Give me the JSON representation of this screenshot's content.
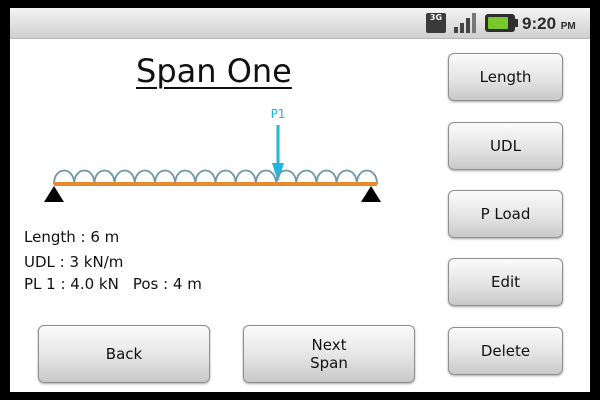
{
  "status_bar": {
    "network": "3G",
    "time": "9:20",
    "ampm": "PM",
    "icons": [
      "3g-icon",
      "signal-icon",
      "battery-icon"
    ]
  },
  "title": "Span One",
  "diagram": {
    "load_label": "P1",
    "colors": {
      "beam": "#e58a2d",
      "udl": "#6f98a7",
      "point_load": "#22b5e0",
      "support": "#000000"
    }
  },
  "info": {
    "length": "Length : 6 m",
    "udl": "UDL : 3 kN/m",
    "pl": "PL 1 : 4.0 kN",
    "pos": "Pos : 4 m"
  },
  "buttons": {
    "length": "Length",
    "udl": "UDL",
    "pload": "P Load",
    "edit": "Edit",
    "delete": "Delete",
    "back": "Back",
    "next_line1": "Next",
    "next_line2": "Span"
  }
}
